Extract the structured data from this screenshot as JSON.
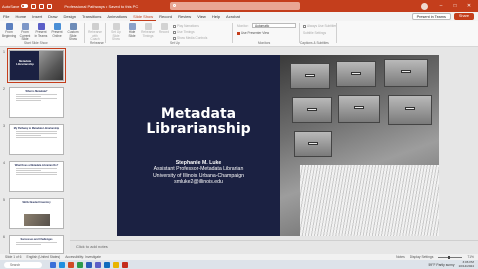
{
  "titlebar": {
    "autosave_label": "AutoSave",
    "autosave_state": "On",
    "doc_title": "Professional Pathways • Saved to this PC",
    "search_placeholder": "Search",
    "colors": {
      "brand": "#c43e1c"
    }
  },
  "menu": {
    "tabs": [
      "File",
      "Home",
      "Insert",
      "Draw",
      "Design",
      "Transitions",
      "Animations",
      "Slide Show",
      "Record",
      "Review",
      "View",
      "Help",
      "Acrobat"
    ],
    "active_tab": "Slide Show",
    "present_label": "Present in Teams",
    "share_label": "Share"
  },
  "ribbon": {
    "start": [
      {
        "label": "From Beginning"
      },
      {
        "label": "From Current Slide"
      },
      {
        "label": "Present in Teams"
      },
      {
        "label": "Present Online"
      },
      {
        "label": "Custom Slide Show"
      }
    ],
    "start_group_label": "Start Slide Show",
    "rehearse": [
      {
        "label": "Rehearse with Coach"
      }
    ],
    "rehearse_group_label": "Rehearse",
    "setup": [
      {
        "label": "Set Up Slide Show"
      },
      {
        "label": "Hide Slide"
      },
      {
        "label": "Rehearse Timings"
      },
      {
        "label": "Record"
      }
    ],
    "setup_options": [
      "Play Narrations",
      "Use Timings",
      "Show Media Controls"
    ],
    "setup_group_label": "Set Up",
    "monitor_label": "Monitor:",
    "monitor_value": "Automatic",
    "presenter_view_label": "Use Presenter View",
    "monitors_group_label": "Monitors",
    "captions": [
      "Always Use Subtitles",
      "Subtitle Settings"
    ],
    "captions_group_label": "Captions & Subtitles"
  },
  "thumbnails": [
    {
      "num": "1",
      "title": "Metadata Librarianship"
    },
    {
      "num": "2",
      "title": "What is Metadata?"
    },
    {
      "num": "3",
      "title": "My Pathway to Metadata Librarianship"
    },
    {
      "num": "4",
      "title": "What Does a Metadata Librarian Do?"
    },
    {
      "num": "5",
      "title": "Skills Needed Inventory"
    },
    {
      "num": "6",
      "title": "Successes and Challenges"
    }
  ],
  "slide": {
    "title_line1": "Metadata",
    "title_line2": "Librarianship",
    "name": "Stephanie M. Luke",
    "role": "Assistant Professor-Metadata Librarian",
    "affiliation": "University of Illinois Urbana-Champaign",
    "email": "smluke2@illinois.edu"
  },
  "notes_placeholder": "Click to add notes",
  "statusbar": {
    "slide_pos": "Slide 1 of 6",
    "language": "English (United States)",
    "accessibility": "Accessibility: Investigate",
    "notes_label": "Notes",
    "display_settings": "Display Settings",
    "zoom": "71%"
  },
  "taskbar": {
    "search_placeholder": "Search",
    "weather": "59°F  Partly sunny",
    "time": "3:06 PM",
    "date": "10/14/2024"
  }
}
